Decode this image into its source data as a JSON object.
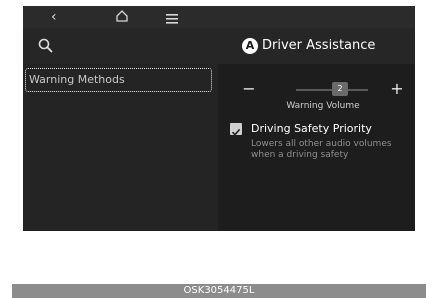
{
  "topbar": {
    "back_icon": "chevron-left-icon",
    "home_icon": "home-icon",
    "menu_icon": "menu-icon"
  },
  "header": {
    "badge": "A",
    "title": "Driver Assistance",
    "search_icon": "search-icon"
  },
  "sidebar": {
    "items": [
      {
        "label": "Warning Methods",
        "selected": true
      }
    ]
  },
  "warning_volume": {
    "label": "Warning Volume",
    "value": "2",
    "decrease": "−",
    "increase": "+"
  },
  "driving_safety_priority": {
    "label": "Driving Safety Priority",
    "checked": true,
    "description": "Lowers all other audio volumes when a driving safety"
  },
  "caption": "OSK3054475L"
}
